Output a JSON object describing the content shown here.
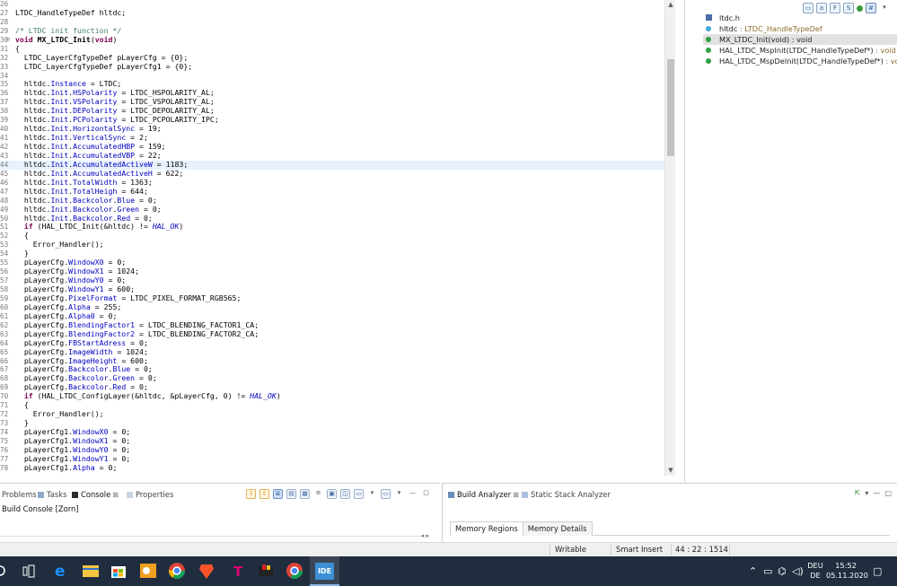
{
  "editor": {
    "lines": [
      {
        "n": "26",
        "html": ""
      },
      {
        "n": "27",
        "html": "LTDC_HandleTypeDef hltdc;"
      },
      {
        "n": "28",
        "html": ""
      },
      {
        "n": "29",
        "html": "<span class=\"cmt\">/* LTDC init function */</span>"
      },
      {
        "n": "30",
        "fold": true,
        "html": "<span class=\"kw\">void</span> <b>MX_LTDC_Init</b>(<span class=\"kw\">void</span>)"
      },
      {
        "n": "31",
        "html": "{"
      },
      {
        "n": "32",
        "html": "  LTDC_LayerCfgTypeDef pLayerCfg = {0};"
      },
      {
        "n": "33",
        "html": "  LTDC_LayerCfgTypeDef pLayerCfg1 = {0};"
      },
      {
        "n": "34",
        "html": ""
      },
      {
        "n": "35",
        "html": "  hltdc.<span class=\"fld\">Instance</span> = LTDC;"
      },
      {
        "n": "36",
        "html": "  hltdc.<span class=\"fld\">Init</span>.<span class=\"fld\">HSPolarity</span> = LTDC_HSPOLARITY_AL;"
      },
      {
        "n": "37",
        "html": "  hltdc.<span class=\"fld\">Init</span>.<span class=\"fld\">VSPolarity</span> = LTDC_VSPOLARITY_AL;"
      },
      {
        "n": "38",
        "html": "  hltdc.<span class=\"fld\">Init</span>.<span class=\"fld\">DEPolarity</span> = LTDC_DEPOLARITY_AL;"
      },
      {
        "n": "39",
        "html": "  hltdc.<span class=\"fld\">Init</span>.<span class=\"fld\">PCPolarity</span> = LTDC_PCPOLARITY_IPC;"
      },
      {
        "n": "40",
        "html": "  hltdc.<span class=\"fld\">Init</span>.<span class=\"fld\">HorizontalSync</span> = 19;"
      },
      {
        "n": "41",
        "html": "  hltdc.<span class=\"fld\">Init</span>.<span class=\"fld\">VerticalSync</span> = 2;"
      },
      {
        "n": "42",
        "html": "  hltdc.<span class=\"fld\">Init</span>.<span class=\"fld\">AccumulatedHBP</span> = 159;"
      },
      {
        "n": "43",
        "html": "  hltdc.<span class=\"fld\">Init</span>.<span class=\"fld\">AccumulatedVBP</span> = 22;"
      },
      {
        "n": "44",
        "current": true,
        "html": "  hltdc.<span class=\"fld\">Init</span>.<span class=\"fld\">AccumulatedActiveW</span> = 1183;"
      },
      {
        "n": "45",
        "html": "  hltdc.<span class=\"fld\">Init</span>.<span class=\"fld\">AccumulatedActiveH</span> = 622;"
      },
      {
        "n": "46",
        "html": "  hltdc.<span class=\"fld\">Init</span>.<span class=\"fld\">TotalWidth</span> = 1363;"
      },
      {
        "n": "47",
        "html": "  hltdc.<span class=\"fld\">Init</span>.<span class=\"fld\">TotalHeigh</span> = 644;"
      },
      {
        "n": "48",
        "html": "  hltdc.<span class=\"fld\">Init</span>.<span class=\"fld\">Backcolor</span>.<span class=\"fld\">Blue</span> = 0;"
      },
      {
        "n": "49",
        "html": "  hltdc.<span class=\"fld\">Init</span>.<span class=\"fld\">Backcolor</span>.<span class=\"fld\">Green</span> = 0;"
      },
      {
        "n": "50",
        "html": "  hltdc.<span class=\"fld\">Init</span>.<span class=\"fld\">Backcolor</span>.<span class=\"fld\">Red</span> = 0;"
      },
      {
        "n": "51",
        "html": "  <span class=\"kw\">if</span> (HAL_LTDC_Init(&amp;hltdc) != <span class=\"mac\">HAL_OK</span>)"
      },
      {
        "n": "52",
        "html": "  {"
      },
      {
        "n": "53",
        "html": "    Error_Handler();"
      },
      {
        "n": "54",
        "html": "  }"
      },
      {
        "n": "55",
        "html": "  pLayerCfg.<span class=\"fld\">WindowX0</span> = 0;"
      },
      {
        "n": "56",
        "html": "  pLayerCfg.<span class=\"fld\">WindowX1</span> = 1024;"
      },
      {
        "n": "57",
        "html": "  pLayerCfg.<span class=\"fld\">WindowY0</span> = 0;"
      },
      {
        "n": "58",
        "html": "  pLayerCfg.<span class=\"fld\">WindowY1</span> = 600;"
      },
      {
        "n": "59",
        "html": "  pLayerCfg.<span class=\"fld\">PixelFormat</span> = LTDC_PIXEL_FORMAT_RGB565;"
      },
      {
        "n": "60",
        "html": "  pLayerCfg.<span class=\"fld\">Alpha</span> = 255;"
      },
      {
        "n": "61",
        "html": "  pLayerCfg.<span class=\"fld\">Alpha0</span> = 0;"
      },
      {
        "n": "62",
        "html": "  pLayerCfg.<span class=\"fld\">BlendingFactor1</span> = LTDC_BLENDING_FACTOR1_CA;"
      },
      {
        "n": "63",
        "html": "  pLayerCfg.<span class=\"fld\">BlendingFactor2</span> = LTDC_BLENDING_FACTOR2_CA;"
      },
      {
        "n": "64",
        "html": "  pLayerCfg.<span class=\"fld\">FBStartAdress</span> = 0;"
      },
      {
        "n": "65",
        "html": "  pLayerCfg.<span class=\"fld\">ImageWidth</span> = 1024;"
      },
      {
        "n": "66",
        "html": "  pLayerCfg.<span class=\"fld\">ImageHeight</span> = 600;"
      },
      {
        "n": "67",
        "html": "  pLayerCfg.<span class=\"fld\">Backcolor</span>.<span class=\"fld\">Blue</span> = 0;"
      },
      {
        "n": "68",
        "html": "  pLayerCfg.<span class=\"fld\">Backcolor</span>.<span class=\"fld\">Green</span> = 0;"
      },
      {
        "n": "69",
        "html": "  pLayerCfg.<span class=\"fld\">Backcolor</span>.<span class=\"fld\">Red</span> = 0;"
      },
      {
        "n": "70",
        "html": "  <span class=\"kw\">if</span> (HAL_LTDC_ConfigLayer(&amp;hltdc, &amp;pLayerCfg, 0) != <span class=\"mac\">HAL_OK</span>)"
      },
      {
        "n": "71",
        "html": "  {"
      },
      {
        "n": "72",
        "html": "    Error_Handler();"
      },
      {
        "n": "73",
        "html": "  }"
      },
      {
        "n": "74",
        "html": "  pLayerCfg1.<span class=\"fld\">WindowX0</span> = 0;"
      },
      {
        "n": "75",
        "html": "  pLayerCfg1.<span class=\"fld\">WindowX1</span> = 0;"
      },
      {
        "n": "76",
        "html": "  pLayerCfg1.<span class=\"fld\">WindowY0</span> = 0;"
      },
      {
        "n": "77",
        "html": "  pLayerCfg1.<span class=\"fld\">WindowY1</span> = 0;"
      },
      {
        "n": "78",
        "html": "  pLayerCfg1.<span class=\"fld\">Alpha</span> = 0;"
      }
    ]
  },
  "outline": {
    "items": [
      {
        "icon": "hash",
        "label": "ltdc.h",
        "type": ""
      },
      {
        "icon": "field",
        "label": "hltdc",
        "type": " : LTDC_HandleTypeDef"
      },
      {
        "icon": "method",
        "label": "MX_LTDC_Init(void) : void",
        "type": "",
        "selected": true
      },
      {
        "icon": "method",
        "label": "HAL_LTDC_MspInit(LTDC_HandleTypeDef*)",
        "type": " : void"
      },
      {
        "icon": "method",
        "label": "HAL_LTDC_MspDeInit(LTDC_HandleTypeDef*)",
        "type": " : void"
      }
    ]
  },
  "panels": {
    "tab_problems": "Problems",
    "tab_tasks": "Tasks",
    "tab_console": "Console",
    "tab_properties": "Properties",
    "console_label": "Build Console [Zorn]",
    "tab_build_analyzer": "Build Analyzer",
    "tab_static_stack": "Static Stack Analyzer",
    "tab_memory_regions": "Memory Regions",
    "tab_memory_details": "Memory Details"
  },
  "status": {
    "writable": "Writable",
    "insert_mode": "Smart Insert",
    "position": "44 : 22 : 1514"
  },
  "taskbar": {
    "ide_label": "IDE",
    "lang_top": "DEU",
    "lang_bottom": "DE",
    "time": "15:52",
    "date": "05.11.2020"
  }
}
